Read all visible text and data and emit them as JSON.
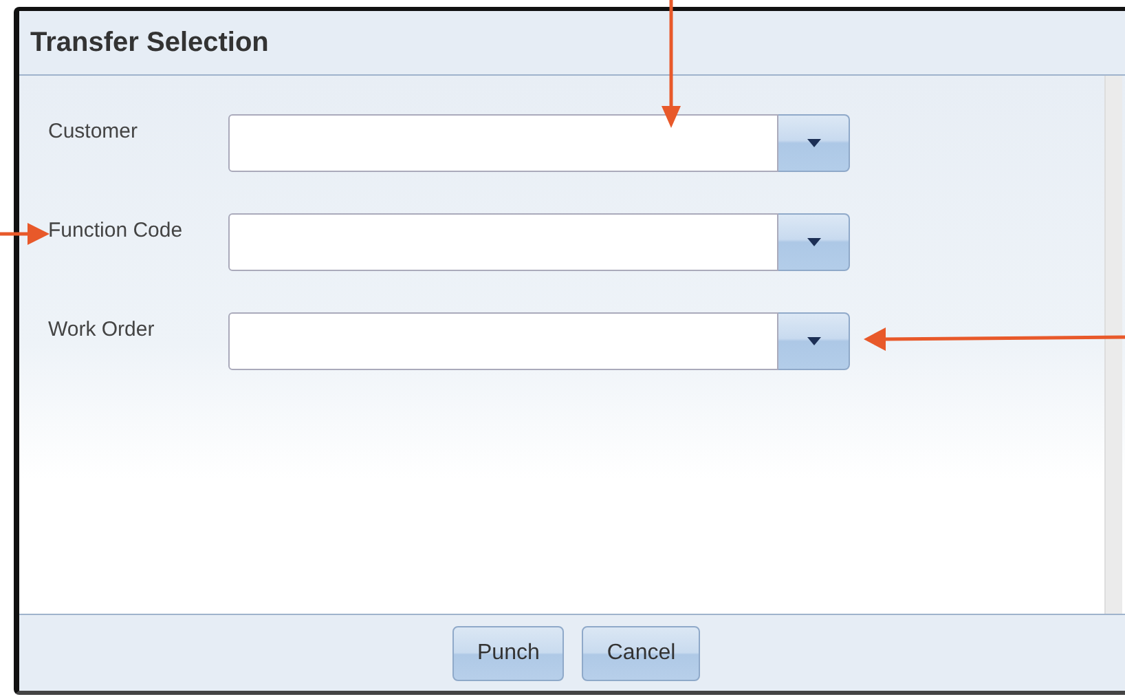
{
  "window": {
    "title": "Transfer Selection"
  },
  "fields": [
    {
      "label": "Customer"
    },
    {
      "label": "Function Code"
    },
    {
      "label": "Work Order"
    }
  ],
  "buttons": [
    "Punch",
    "Cancel"
  ]
}
